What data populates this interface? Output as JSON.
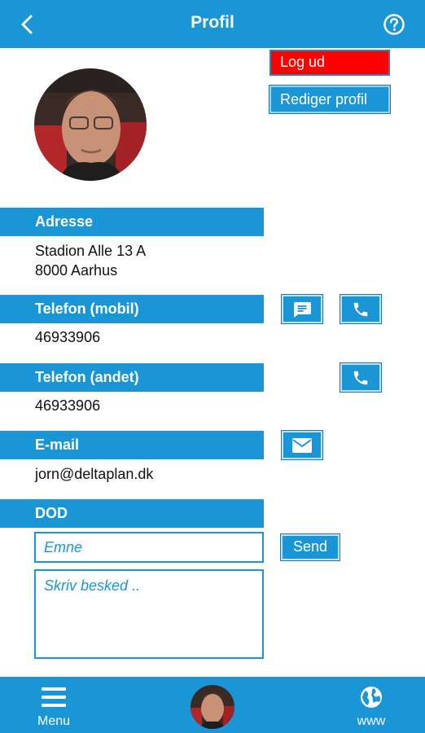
{
  "header": {
    "title": "Profil",
    "back_icon": "chevron-left-icon",
    "help_icon": "help-circle-icon"
  },
  "actions": {
    "logout_label": "Log ud",
    "edit_label": "Rediger profil"
  },
  "address": {
    "heading": "Adresse",
    "line1": "Stadion Alle 13 A",
    "line2": "8000 Aarhus"
  },
  "phone_mobile": {
    "heading": "Telefon (mobil)",
    "value": "46933906"
  },
  "phone_other": {
    "heading": "Telefon (andet)",
    "value": "46933906"
  },
  "email": {
    "heading": "E-mail",
    "value": "jorn@deltaplan.dk"
  },
  "message": {
    "heading": "DOD",
    "subject_placeholder": "Emne",
    "body_placeholder": "Skriv besked ..",
    "send_label": "Send"
  },
  "bottom_nav": {
    "menu_label": "Menu",
    "www_label": "www"
  },
  "colors": {
    "primary": "#1a96d6",
    "logout": "#ff0000",
    "background": "#ffffff"
  }
}
